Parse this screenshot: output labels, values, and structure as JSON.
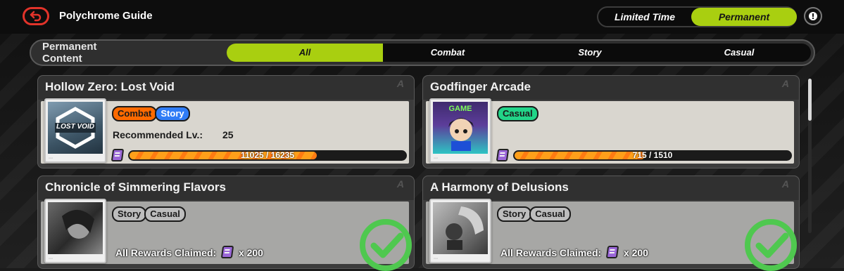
{
  "header": {
    "title": "Polychrome Guide",
    "modes": [
      "Limited Time",
      "Permanent"
    ],
    "active_mode": "Permanent"
  },
  "filter": {
    "title_line1": "Permanent",
    "title_line2": "Content",
    "tabs": [
      "All",
      "Combat",
      "Story",
      "Casual"
    ],
    "active_tab": "All"
  },
  "cards": [
    {
      "title": "Hollow Zero: Lost Void",
      "tags": [
        "Combat",
        "Story"
      ],
      "recommended_label": "Recommended Lv.:",
      "recommended_value": "25",
      "progress_text": "11025 / 16235",
      "progress_fraction": 0.679,
      "thumb_text": "LOST VOID",
      "claimed": false
    },
    {
      "title": "Godfinger Arcade",
      "tags": [
        "Casual"
      ],
      "progress_text": "715 / 1510",
      "progress_fraction": 0.473,
      "thumb_text": "GAME",
      "claimed": false
    },
    {
      "title": "Chronicle of Simmering Flavors",
      "tags": [
        "Story",
        "Casual"
      ],
      "claimed_label": "All Rewards Claimed:",
      "claimed_amount": "x 200",
      "claimed": true
    },
    {
      "title": "A Harmony of Delusions",
      "tags": [
        "Story",
        "Casual"
      ],
      "claimed_label": "All Rewards Claimed:",
      "claimed_amount": "x 200",
      "claimed": true
    }
  ],
  "colors": {
    "accent": "#a9cf10",
    "back": "#e2332a",
    "combat": "#ff6a00",
    "story": "#2f7cf6",
    "casual": "#22d488",
    "progress": "#ff9f1a",
    "check": "#4fc84f"
  },
  "icons": [
    "back-arrow-icon",
    "info-icon",
    "ticket-icon",
    "checkmark-icon"
  ]
}
